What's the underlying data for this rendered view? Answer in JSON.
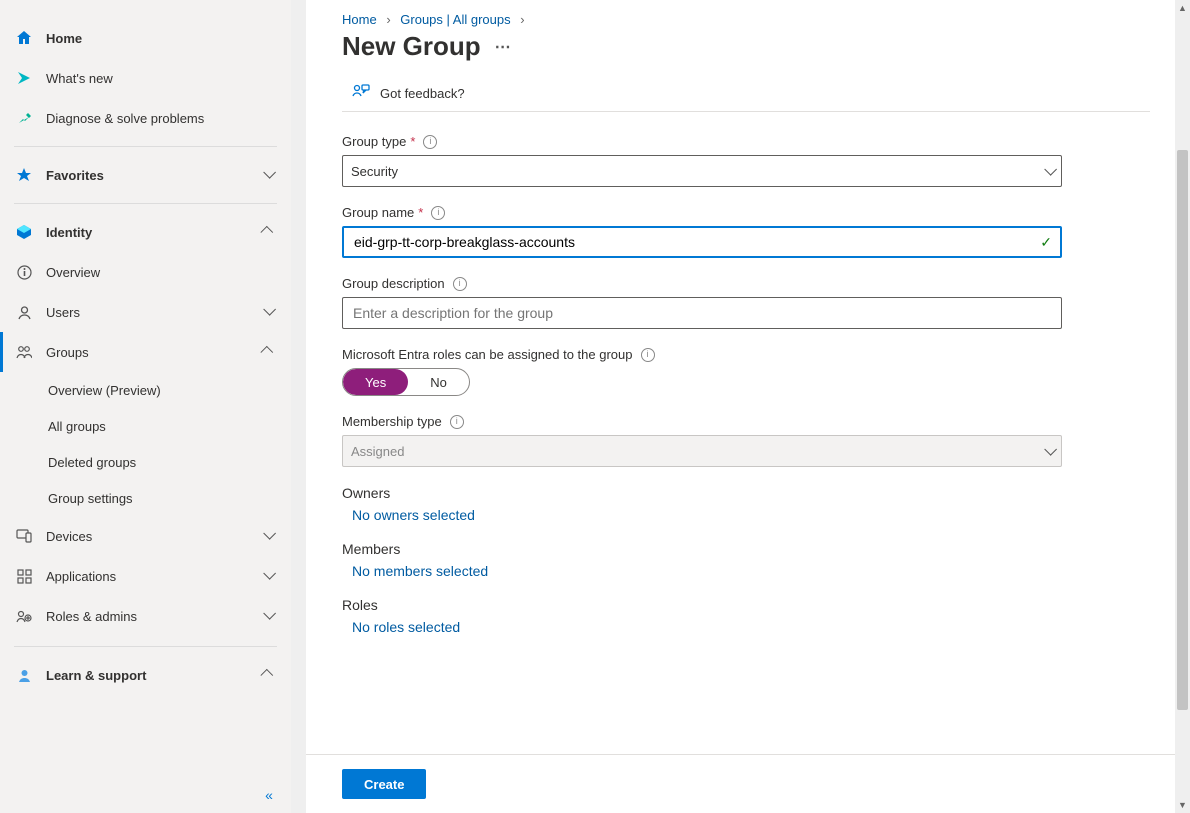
{
  "sidebar": {
    "home": "Home",
    "whatsnew": "What's new",
    "diagnose": "Diagnose & solve problems",
    "favorites": "Favorites",
    "identity": "Identity",
    "identity_items": {
      "overview": "Overview",
      "users": "Users",
      "groups": "Groups",
      "groups_sub": {
        "overview_preview": "Overview (Preview)",
        "all_groups": "All groups",
        "deleted_groups": "Deleted groups",
        "group_settings": "Group settings"
      },
      "devices": "Devices",
      "applications": "Applications",
      "roles_admins": "Roles & admins"
    },
    "learn_support": "Learn & support"
  },
  "breadcrumb": {
    "home": "Home",
    "groups": "Groups | All groups"
  },
  "page_title": "New Group",
  "feedback": "Got feedback?",
  "form": {
    "group_type_label": "Group type",
    "group_type_value": "Security",
    "group_name_label": "Group name",
    "group_name_value": "eid-grp-tt-corp-breakglass-accounts",
    "group_desc_label": "Group description",
    "group_desc_placeholder": "Enter a description for the group",
    "roles_assign_label": "Microsoft Entra roles can be assigned to the group",
    "toggle_yes": "Yes",
    "toggle_no": "No",
    "membership_type_label": "Membership type",
    "membership_type_value": "Assigned",
    "owners_label": "Owners",
    "owners_link": "No owners selected",
    "members_label": "Members",
    "members_link": "No members selected",
    "roles_label": "Roles",
    "roles_link": "No roles selected"
  },
  "create_btn": "Create"
}
